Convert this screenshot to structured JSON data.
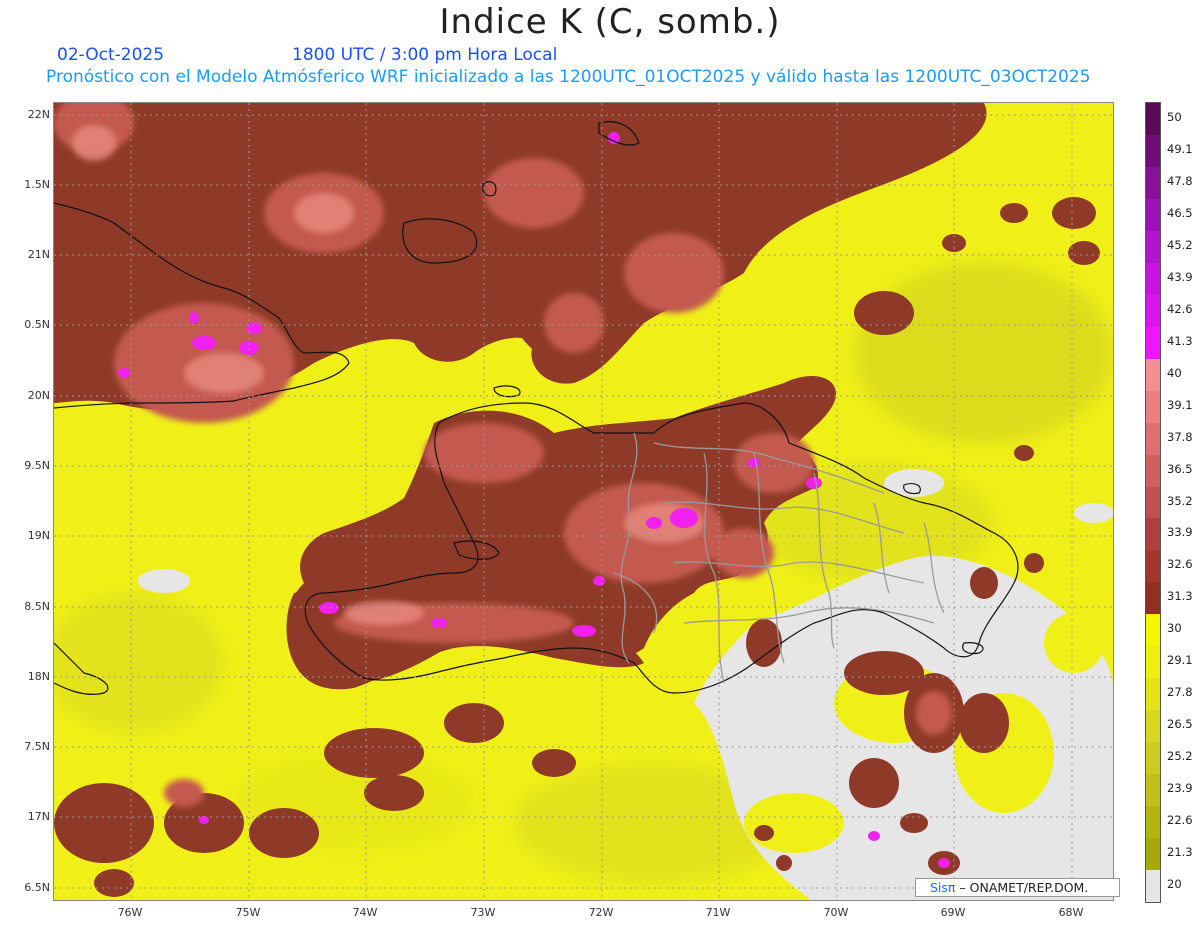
{
  "title": "Indice K (C, somb.)",
  "header": {
    "date": "02-Oct-2025",
    "time": "1800 UTC / 3:00 pm Hora Local",
    "model": "Pronóstico con el Modelo Atmósferico WRF inicializado a las 1200UTC_01OCT2025 y válido hasta las  1200UTC_03OCT2025"
  },
  "axes": {
    "lat_labels": [
      "22N",
      "1.5N",
      "21N",
      "0.5N",
      "20N",
      "9.5N",
      "19N",
      "8.5N",
      "18N",
      "7.5N",
      "17N",
      "6.5N"
    ],
    "lon_labels": [
      "76W",
      "75W",
      "74W",
      "73W",
      "72W",
      "71W",
      "70W",
      "69W",
      "68W"
    ]
  },
  "colorbar": {
    "labels": [
      "50",
      "49.1",
      "47.8",
      "46.5",
      "45.2",
      "43.9",
      "42.6",
      "41.3",
      "40",
      "39.1",
      "37.8",
      "36.5",
      "35.2",
      "33.9",
      "32.6",
      "31.3",
      "30",
      "29.1",
      "27.8",
      "26.5",
      "25.2",
      "23.9",
      "22.6",
      "21.3",
      "20"
    ],
    "colors": [
      "#5a0a5a",
      "#6e0f78",
      "#861296",
      "#9c12b4",
      "#b014cc",
      "#c814e0",
      "#dc14f0",
      "#f014ff",
      "#f09090",
      "#e98080",
      "#dc7070",
      "#cf6060",
      "#c05050",
      "#b04040",
      "#a03830",
      "#8f3020",
      "#f6f600",
      "#eeee10",
      "#e3e318",
      "#d8d820",
      "#cccc20",
      "#c0c018",
      "#b4b410",
      "#a8a808",
      "#e6e6e6"
    ]
  },
  "brand": {
    "sis": "Sisπ",
    "rest": " – ONAMET/REP.DOM."
  },
  "colors": {
    "low": "#e8e8e8",
    "yellow": "#f0f018",
    "yellow_dark": "#cccc20",
    "brown": "#8f3a28",
    "brown_light": "#c45a50",
    "pink": "#d86a60",
    "magenta": "#f020f0",
    "coast": "#111111",
    "border": "#9a9a9a"
  }
}
